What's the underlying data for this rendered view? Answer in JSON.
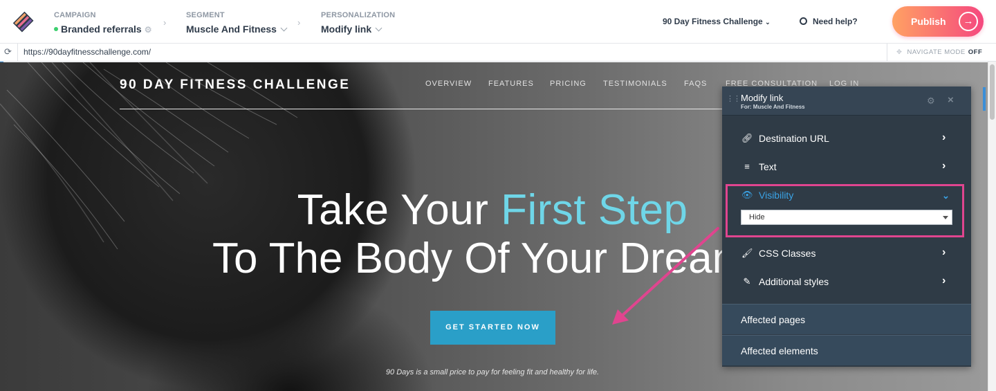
{
  "topbar": {
    "campaign_label": "CAMPAIGN",
    "campaign_value": "Branded referrals",
    "segment_label": "SEGMENT",
    "segment_value": "Muscle And Fitness",
    "personalization_label": "PERSONALIZATION",
    "personalization_value": "Modify link",
    "site_selector": "90 Day Fitness Challenge",
    "help": "Need help?",
    "publish": "Publish"
  },
  "urlbar": {
    "url": "https://90dayfitnesschallenge.com/",
    "navigate_mode_label": "NAVIGATE MODE",
    "navigate_mode_value": "OFF"
  },
  "site": {
    "brand": "90 DAY FITNESS CHALLENGE",
    "nav": [
      "OVERVIEW",
      "FEATURES",
      "PRICING",
      "TESTIMONIALS",
      "FAQS",
      "FREE CONSULTATION",
      "LOG IN"
    ],
    "headline_part1": "Take Your ",
    "headline_highlight": "First Step",
    "headline_line2": "To The Body Of Your Dreams",
    "cta": "GET STARTED NOW",
    "tagline": "90 Days is a small price to pay for feeling fit and healthy for life."
  },
  "panel": {
    "title": "Modify link",
    "subtitle": "For: Muscle And Fitness",
    "rows": [
      {
        "label": "Destination URL",
        "icon": "link-icon"
      },
      {
        "label": "Text",
        "icon": "text-align-icon"
      },
      {
        "label": "Visibility",
        "icon": "eye-icon"
      },
      {
        "label": "CSS Classes",
        "icon": "brush-icon"
      },
      {
        "label": "Additional styles",
        "icon": "pencil-icon"
      }
    ],
    "visibility_value": "Hide",
    "affected_pages": "Affected pages",
    "affected_elements": "Affected elements"
  },
  "colors": {
    "accent_blue": "#3aa3e6",
    "highlight_pink": "#e0458f",
    "publish_gradient_start": "#ffa163",
    "publish_gradient_end": "#f5487f",
    "cta_blue": "#2a9fc8",
    "headline_highlight": "#6fd6e8"
  }
}
